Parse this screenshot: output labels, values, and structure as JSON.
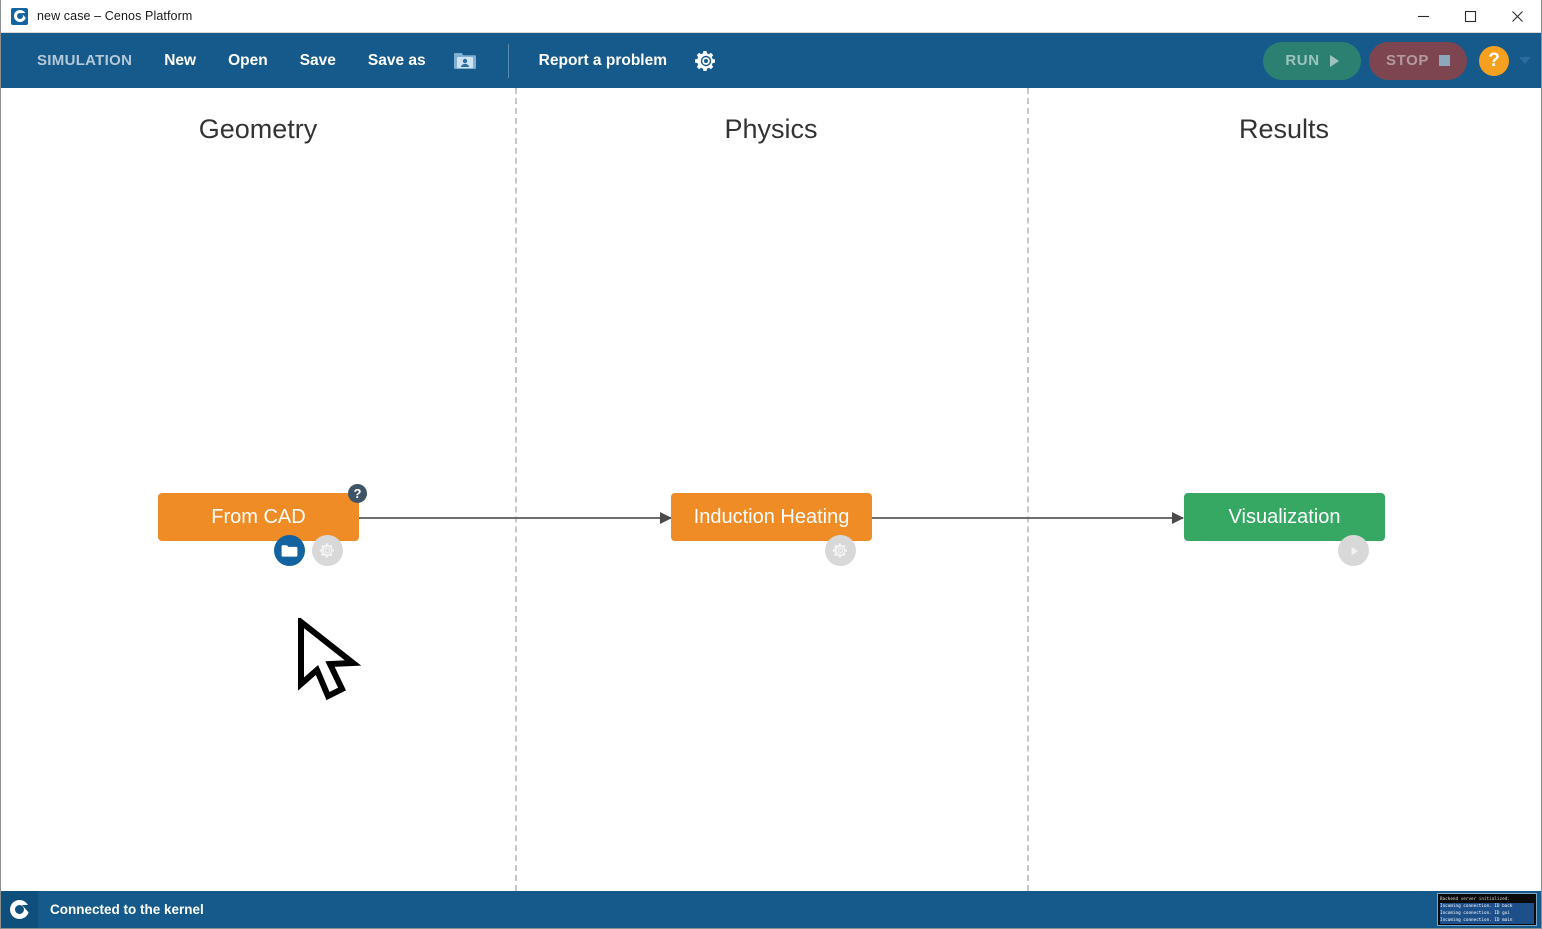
{
  "window": {
    "title": "new case – Cenos Platform",
    "app_icon": "cenos-logo-icon",
    "controls": {
      "minimize": "minimize-icon",
      "maximize": "maximize-icon",
      "close": "close-icon"
    }
  },
  "toolbar": {
    "brand": "SIMULATION",
    "items": [
      {
        "label": "New",
        "name": "new"
      },
      {
        "label": "Open",
        "name": "open"
      },
      {
        "label": "Save",
        "name": "save"
      },
      {
        "label": "Save as",
        "name": "save-as"
      }
    ],
    "folder_icon": "folder-user-icon",
    "report_label": "Report a problem",
    "settings_icon": "gear-icon",
    "run_label": "RUN",
    "stop_label": "STOP",
    "help_label": "?",
    "dropdown_icon": "chevron-down-icon",
    "colors": {
      "toolbar_bg": "#155a8a",
      "run_bg": "#2b8071",
      "stop_bg": "#7d4550",
      "help_bg": "#f5a01e"
    }
  },
  "canvas": {
    "columns": [
      {
        "title": "Geometry",
        "name": "geometry"
      },
      {
        "title": "Physics",
        "name": "physics"
      },
      {
        "title": "Results",
        "name": "results"
      }
    ],
    "nodes": [
      {
        "label": "From CAD",
        "name": "node-from-cad",
        "color": "#ef8c26",
        "badge": "?",
        "buttons": [
          {
            "icon": "folder-icon",
            "name": "open-cad-file-button",
            "style": "blue"
          },
          {
            "icon": "gear-icon",
            "name": "from-cad-settings-button",
            "style": "grey"
          }
        ]
      },
      {
        "label": "Induction Heating",
        "name": "node-induction-heating",
        "color": "#ef8c26",
        "badge": "",
        "buttons": [
          {
            "icon": "gear-icon",
            "name": "induction-heating-settings-button",
            "style": "grey"
          }
        ]
      },
      {
        "label": "Visualization",
        "name": "node-visualization",
        "color": "#36a864",
        "badge": "",
        "buttons": [
          {
            "icon": "play-icon",
            "name": "visualization-run-button",
            "style": "grey"
          }
        ]
      }
    ]
  },
  "statusbar": {
    "logo": "cenos-logo-icon",
    "message": "Connected to the kernel",
    "console_lines": [
      "Backend server initialized.",
      "Incoming connection. ID back",
      "Incoming connection. ID gui",
      "Incoming connection. ID main"
    ]
  }
}
